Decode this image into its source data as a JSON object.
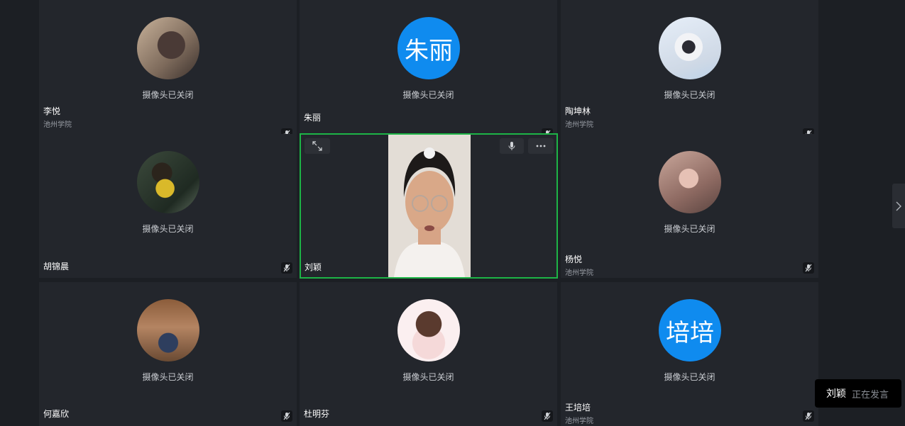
{
  "camera_off_text": "摄像头已关闭",
  "participants": [
    {
      "name": "李悦",
      "org": "池州学院",
      "avatar": "photo"
    },
    {
      "name": "朱丽",
      "org": "",
      "avatar": "text",
      "avatar_text": "朱丽"
    },
    {
      "name": "陶坤林",
      "org": "池州学院",
      "avatar": "photo"
    },
    {
      "name": "胡锦晨",
      "org": "",
      "avatar": "photo"
    },
    {
      "name": "刘颖",
      "org": "",
      "avatar": "video"
    },
    {
      "name": "杨悦",
      "org": "池州学院",
      "avatar": "photo"
    },
    {
      "name": "何嘉欣",
      "org": "",
      "avatar": "photo"
    },
    {
      "name": "杜明芬",
      "org": "",
      "avatar": "photo"
    },
    {
      "name": "王培培",
      "org": "池州学院",
      "avatar": "text",
      "avatar_text": "培培"
    }
  ],
  "speaking": {
    "name": "刘颖",
    "status": "正在发言"
  },
  "colors": {
    "accent_active": "#1db446",
    "avatar_blue": "#0f8bef"
  }
}
